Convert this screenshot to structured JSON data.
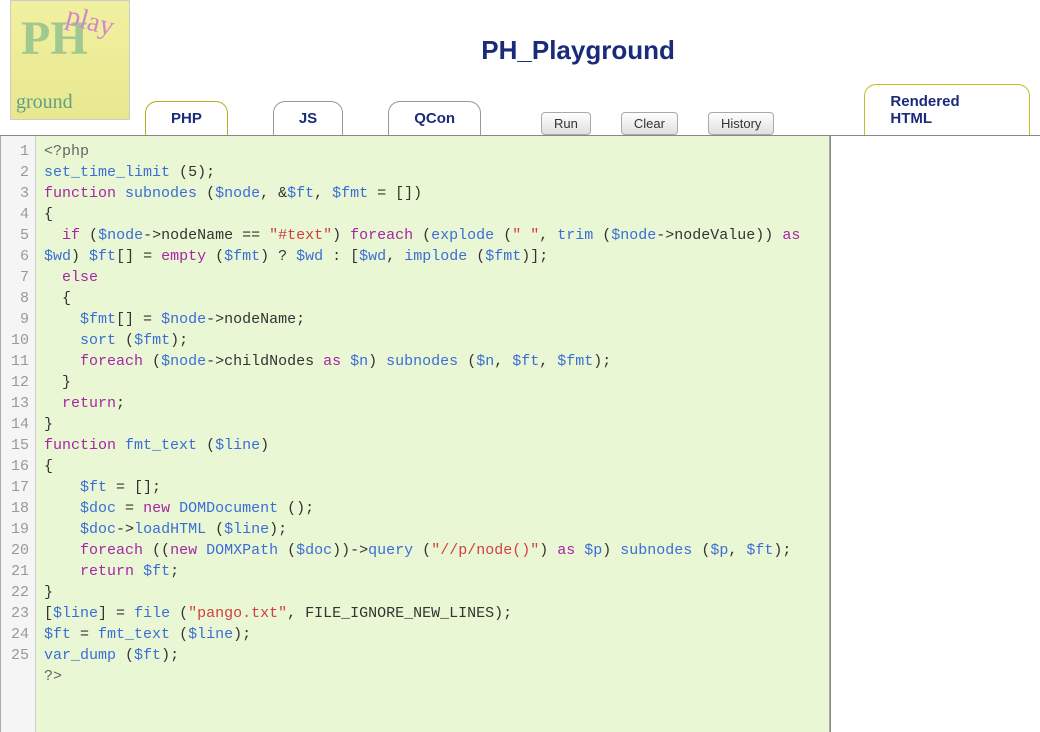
{
  "app": {
    "title": "PH_Playground",
    "logo": {
      "p1": "PH",
      "p2": "play",
      "p3": "ground"
    }
  },
  "tabs": {
    "php": "PHP",
    "js": "JS",
    "qcon": "QCon",
    "rendered": "Rendered HTML"
  },
  "buttons": {
    "run": "Run",
    "clear": "Clear",
    "history": "History"
  },
  "code": {
    "lines": 25,
    "tokens": [
      [
        [
          "op",
          "<?php"
        ]
      ],
      [
        [
          "fn",
          "set_time_limit"
        ],
        [
          "plain",
          " ("
        ],
        [
          "plain",
          "5"
        ],
        [
          "plain",
          ");"
        ]
      ],
      [
        [
          "kw",
          "function"
        ],
        [
          "plain",
          " "
        ],
        [
          "fn",
          "subnodes"
        ],
        [
          "plain",
          " ("
        ],
        [
          "var",
          "$node"
        ],
        [
          "plain",
          ", &"
        ],
        [
          "var",
          "$ft"
        ],
        [
          "plain",
          ", "
        ],
        [
          "var",
          "$fmt"
        ],
        [
          "plain",
          " = [])"
        ]
      ],
      [
        [
          "plain",
          "{"
        ]
      ],
      [
        [
          "plain",
          "  "
        ],
        [
          "kw",
          "if"
        ],
        [
          "plain",
          " ("
        ],
        [
          "var",
          "$node"
        ],
        [
          "plain",
          "->nodeName == "
        ],
        [
          "str",
          "\"#text\""
        ],
        [
          "plain",
          ") "
        ],
        [
          "kw",
          "foreach"
        ],
        [
          "plain",
          " ("
        ],
        [
          "fn",
          "explode"
        ],
        [
          "plain",
          " ("
        ],
        [
          "str",
          "\" \""
        ],
        [
          "plain",
          ", "
        ],
        [
          "fn",
          "trim"
        ],
        [
          "plain",
          " ("
        ],
        [
          "var",
          "$node"
        ],
        [
          "plain",
          "->nodeValue)) "
        ],
        [
          "kw",
          "as"
        ],
        [
          "plain",
          " "
        ],
        [
          "var",
          "$wd"
        ],
        [
          "plain",
          ") "
        ],
        [
          "var",
          "$ft"
        ],
        [
          "plain",
          "[] = "
        ],
        [
          "kw",
          "empty"
        ],
        [
          "plain",
          " ("
        ],
        [
          "var",
          "$fmt"
        ],
        [
          "plain",
          ") ? "
        ],
        [
          "var",
          "$wd"
        ],
        [
          "plain",
          " : ["
        ],
        [
          "var",
          "$wd"
        ],
        [
          "plain",
          ", "
        ],
        [
          "fn",
          "implode"
        ],
        [
          "plain",
          " ("
        ],
        [
          "var",
          "$fmt"
        ],
        [
          "plain",
          ")];"
        ]
      ],
      [
        [
          "plain",
          "  "
        ],
        [
          "kw",
          "else"
        ]
      ],
      [
        [
          "plain",
          "  {"
        ]
      ],
      [
        [
          "plain",
          "    "
        ],
        [
          "var",
          "$fmt"
        ],
        [
          "plain",
          "[] = "
        ],
        [
          "var",
          "$node"
        ],
        [
          "plain",
          "->nodeName;"
        ]
      ],
      [
        [
          "plain",
          "    "
        ],
        [
          "fn",
          "sort"
        ],
        [
          "plain",
          " ("
        ],
        [
          "var",
          "$fmt"
        ],
        [
          "plain",
          ");"
        ]
      ],
      [
        [
          "plain",
          "    "
        ],
        [
          "kw",
          "foreach"
        ],
        [
          "plain",
          " ("
        ],
        [
          "var",
          "$node"
        ],
        [
          "plain",
          "->childNodes "
        ],
        [
          "kw",
          "as"
        ],
        [
          "plain",
          " "
        ],
        [
          "var",
          "$n"
        ],
        [
          "plain",
          ") "
        ],
        [
          "fn",
          "subnodes"
        ],
        [
          "plain",
          " ("
        ],
        [
          "var",
          "$n"
        ],
        [
          "plain",
          ", "
        ],
        [
          "var",
          "$ft"
        ],
        [
          "plain",
          ", "
        ],
        [
          "var",
          "$fmt"
        ],
        [
          "plain",
          ");"
        ]
      ],
      [
        [
          "plain",
          "  }"
        ]
      ],
      [
        [
          "plain",
          "  "
        ],
        [
          "kw",
          "return"
        ],
        [
          "plain",
          ";"
        ]
      ],
      [
        [
          "plain",
          "}"
        ]
      ],
      [
        [
          "kw",
          "function"
        ],
        [
          "plain",
          " "
        ],
        [
          "fn",
          "fmt_text"
        ],
        [
          "plain",
          " ("
        ],
        [
          "var",
          "$line"
        ],
        [
          "plain",
          ")"
        ]
      ],
      [
        [
          "plain",
          "{"
        ]
      ],
      [
        [
          "plain",
          "    "
        ],
        [
          "var",
          "$ft"
        ],
        [
          "plain",
          " = [];"
        ]
      ],
      [
        [
          "plain",
          "    "
        ],
        [
          "var",
          "$doc"
        ],
        [
          "plain",
          " = "
        ],
        [
          "kw",
          "new"
        ],
        [
          "plain",
          " "
        ],
        [
          "fn",
          "DOMDocument"
        ],
        [
          "plain",
          " ();"
        ]
      ],
      [
        [
          "plain",
          "    "
        ],
        [
          "var",
          "$doc"
        ],
        [
          "plain",
          "->"
        ],
        [
          "fn",
          "loadHTML"
        ],
        [
          "plain",
          " ("
        ],
        [
          "var",
          "$line"
        ],
        [
          "plain",
          ");"
        ]
      ],
      [
        [
          "plain",
          "    "
        ],
        [
          "kw",
          "foreach"
        ],
        [
          "plain",
          " (("
        ],
        [
          "kw",
          "new"
        ],
        [
          "plain",
          " "
        ],
        [
          "fn",
          "DOMXPath"
        ],
        [
          "plain",
          " ("
        ],
        [
          "var",
          "$doc"
        ],
        [
          "plain",
          "))->"
        ],
        [
          "fn",
          "query"
        ],
        [
          "plain",
          " ("
        ],
        [
          "str",
          "\"//p/node()\""
        ],
        [
          "plain",
          ") "
        ],
        [
          "kw",
          "as"
        ],
        [
          "plain",
          " "
        ],
        [
          "var",
          "$p"
        ],
        [
          "plain",
          ") "
        ],
        [
          "fn",
          "subnodes"
        ],
        [
          "plain",
          " ("
        ],
        [
          "var",
          "$p"
        ],
        [
          "plain",
          ", "
        ],
        [
          "var",
          "$ft"
        ],
        [
          "plain",
          ");"
        ]
      ],
      [
        [
          "plain",
          "    "
        ],
        [
          "kw",
          "return"
        ],
        [
          "plain",
          " "
        ],
        [
          "var",
          "$ft"
        ],
        [
          "plain",
          ";"
        ]
      ],
      [
        [
          "plain",
          "}"
        ]
      ],
      [
        [
          "plain",
          "["
        ],
        [
          "var",
          "$line"
        ],
        [
          "plain",
          "] = "
        ],
        [
          "fn",
          "file"
        ],
        [
          "plain",
          " ("
        ],
        [
          "str",
          "\"pango.txt\""
        ],
        [
          "plain",
          ", FILE_IGNORE_NEW_LINES);"
        ]
      ],
      [
        [
          "var",
          "$ft"
        ],
        [
          "plain",
          " = "
        ],
        [
          "fn",
          "fmt_text"
        ],
        [
          "plain",
          " ("
        ],
        [
          "var",
          "$line"
        ],
        [
          "plain",
          ");"
        ]
      ],
      [
        [
          "fn",
          "var_dump"
        ],
        [
          "plain",
          " ("
        ],
        [
          "var",
          "$ft"
        ],
        [
          "plain",
          ");"
        ]
      ],
      [
        [
          "op",
          "?>"
        ]
      ]
    ]
  }
}
